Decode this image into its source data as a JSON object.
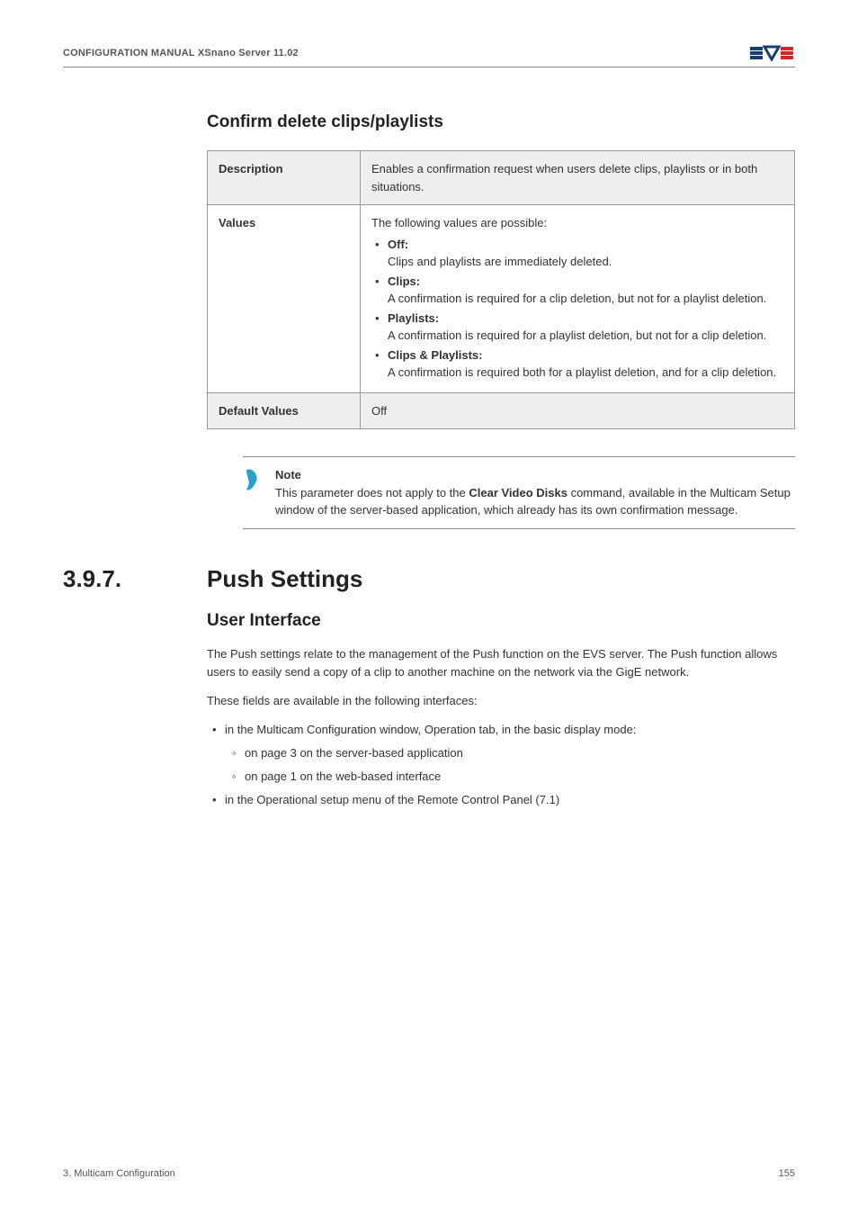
{
  "header": {
    "title": "CONFIGURATION MANUAL  XSnano Server 11.02"
  },
  "section1": {
    "title": "Confirm delete clips/playlists",
    "rows": {
      "description_label": "Description",
      "description_text": "Enables a confirmation request when users delete clips, playlists or in both situations.",
      "values_label": "Values",
      "values_intro": "The following values are possible:",
      "off_label": "Off:",
      "off_text": "Clips and playlists are immediately deleted.",
      "clips_label": "Clips:",
      "clips_text": "A confirmation is required for a clip deletion, but not for a playlist deletion.",
      "playlists_label": "Playlists:",
      "playlists_text": "A confirmation is required for a playlist deletion, but not for a clip deletion.",
      "cp_label": "Clips & Playlists:",
      "cp_text": "A confirmation is required both for a playlist deletion, and for a clip deletion.",
      "default_label": "Default Values",
      "default_value": "Off"
    }
  },
  "note": {
    "label": "Note",
    "text_pre": "This parameter does not apply to the ",
    "bold": "Clear Video Disks",
    "text_post": " command, available in the Multicam Setup window of the server-based application, which already has its own confirmation message."
  },
  "section2": {
    "number": "3.9.7.",
    "title": "Push Settings",
    "subheading": "User Interface",
    "p1": "The Push settings relate to the management of the Push function on the EVS server. The Push function allows users to easily send a copy of a clip to another machine on the network via the GigE network.",
    "p2": "These fields are available in the following interfaces:",
    "b1": "in the Multicam Configuration window, Operation tab, in the basic display mode:",
    "b1a": "on page 3 on the server-based application",
    "b1b": "on page 1 on the web-based interface",
    "b2": "in the Operational setup menu of the Remote Control Panel (7.1)"
  },
  "footer": {
    "left": "3. Multicam Configuration",
    "right": "155"
  }
}
